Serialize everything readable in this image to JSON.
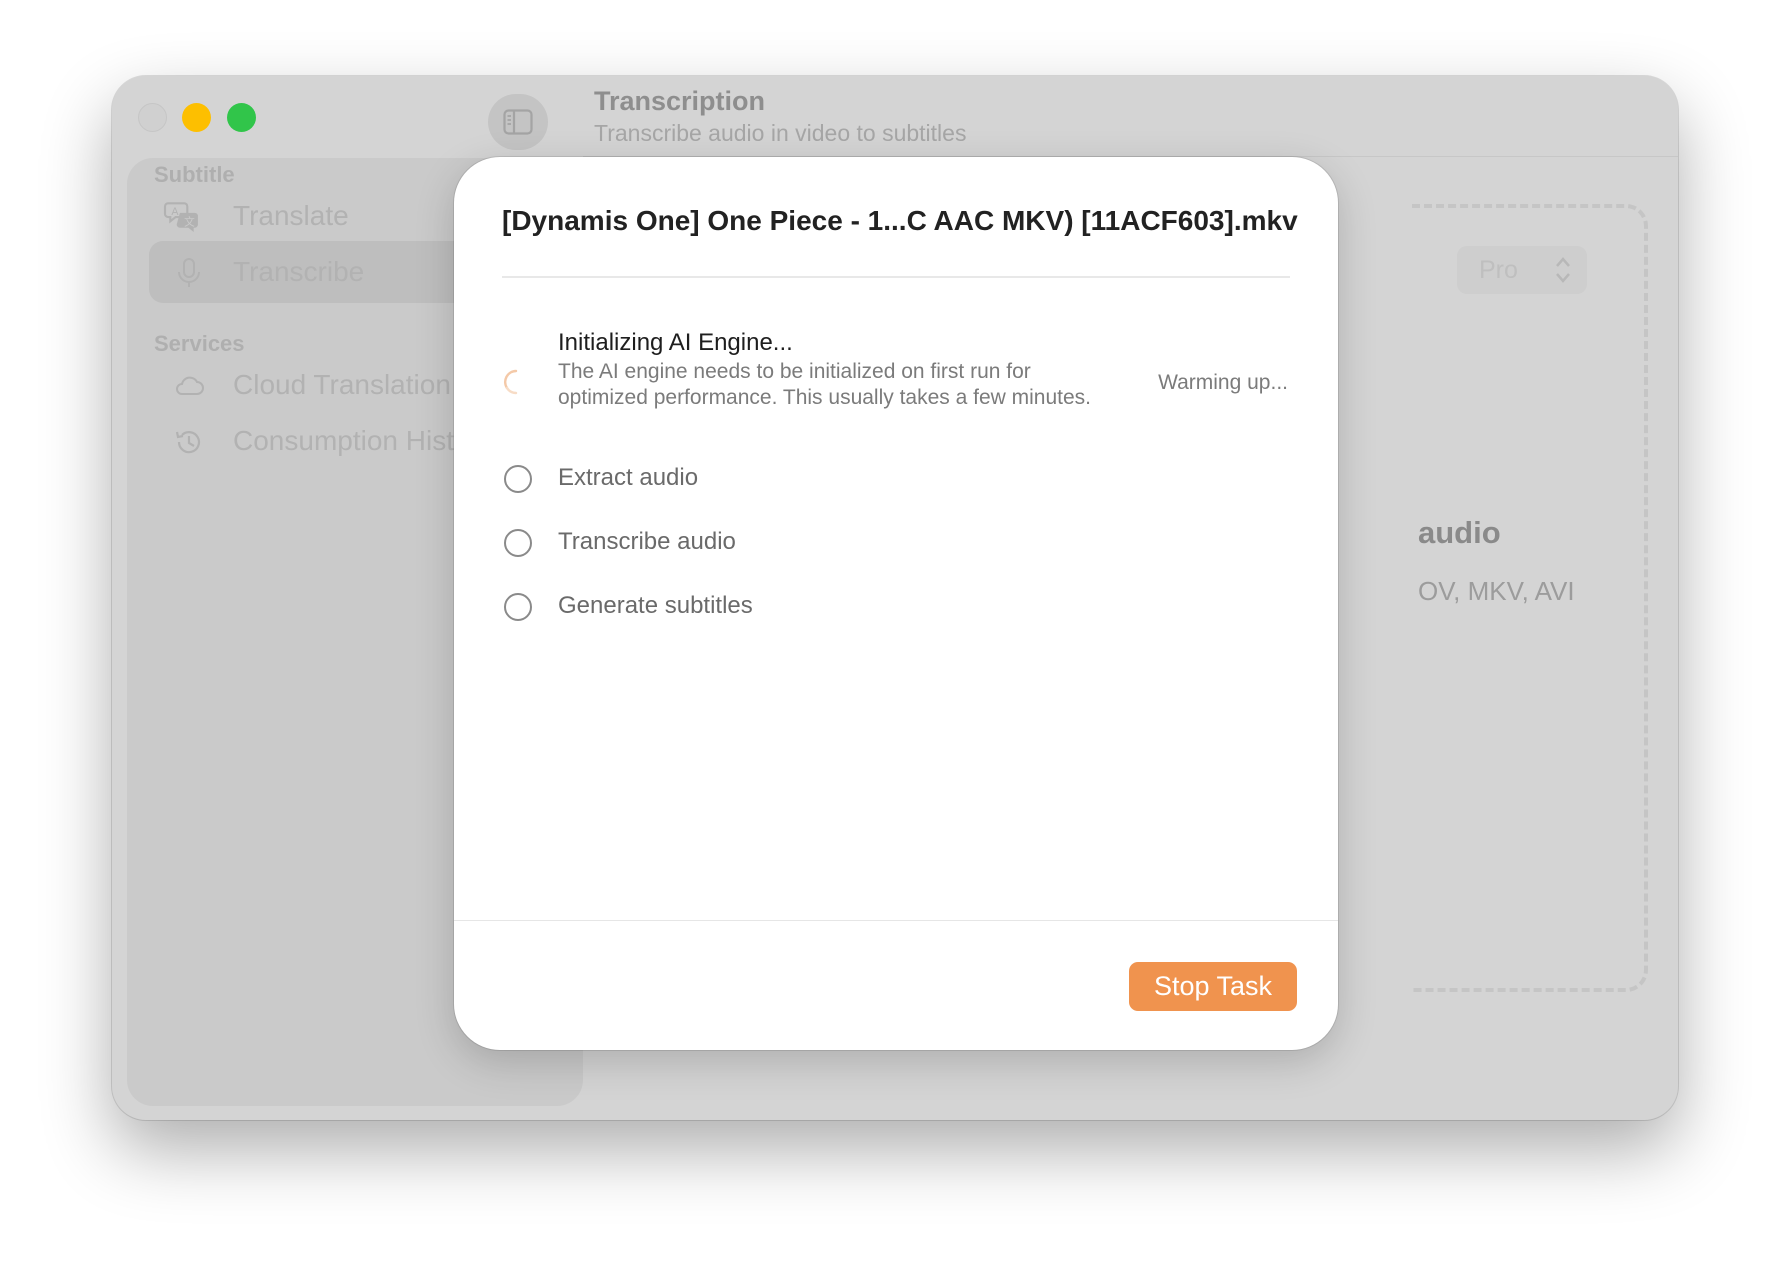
{
  "window": {
    "header": {
      "title": "Transcription",
      "subtitle": "Transcribe audio in video to subtitles"
    },
    "sidebar": {
      "sections": [
        {
          "label": "Subtitle",
          "items": [
            {
              "label": "Translate",
              "icon": "translate-icon",
              "active": false
            },
            {
              "label": "Transcribe",
              "icon": "microphone-icon",
              "active": true
            }
          ]
        },
        {
          "label": "Services",
          "items": [
            {
              "label": "Cloud Translation",
              "icon": "cloud-icon",
              "active": false
            },
            {
              "label": "Consumption Histo",
              "icon": "history-icon",
              "active": false
            }
          ]
        }
      ]
    },
    "background": {
      "model_select": "Pro",
      "drop_title_fragment": "audio",
      "drop_formats_fragment": "OV, MKV, AVI"
    }
  },
  "modal": {
    "file_name": "[Dynamis One] One Piece - 1...C AAC MKV) [11ACF603].mkv",
    "steps": [
      {
        "title": "Initializing AI Engine...",
        "description": "The AI engine needs to be initialized on first run for optimized performance. This usually takes a few minutes.",
        "status_text": "Warming up...",
        "state": "in-progress"
      },
      {
        "title": "Extract audio",
        "state": "pending"
      },
      {
        "title": "Transcribe audio",
        "state": "pending"
      },
      {
        "title": "Generate subtitles",
        "state": "pending"
      }
    ],
    "stop_button_label": "Stop Task"
  },
  "colors": {
    "accent": "#f0934e",
    "traffic_min": "#fdbf00",
    "traffic_max": "#31c54a"
  }
}
